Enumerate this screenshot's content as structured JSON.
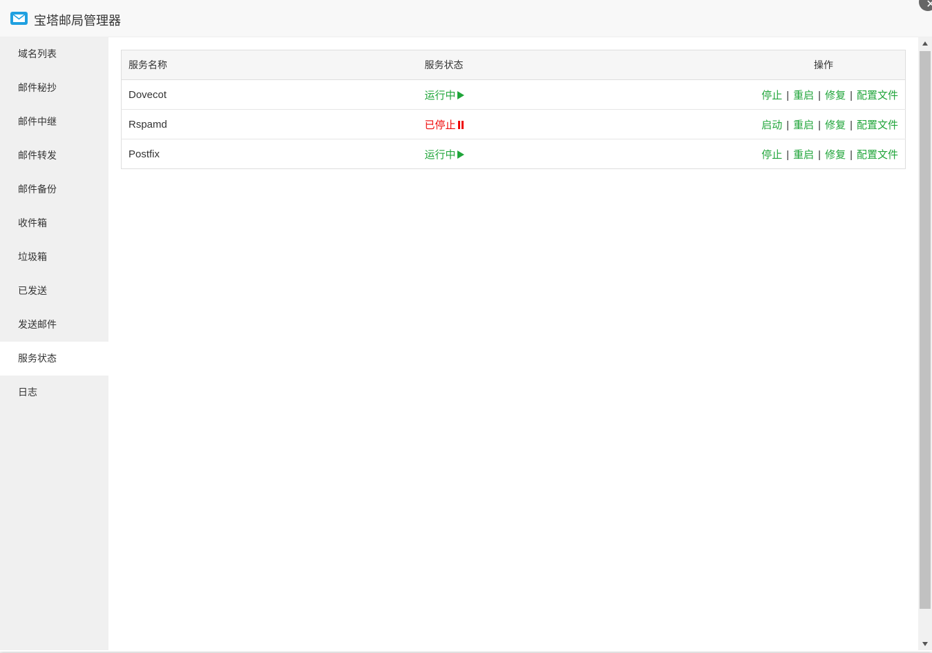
{
  "window": {
    "title": "宝塔邮局管理器",
    "icon": "mail-icon",
    "close_icon": "close-icon"
  },
  "sidebar": {
    "items": [
      {
        "label": "域名列表"
      },
      {
        "label": "邮件秘抄"
      },
      {
        "label": "邮件中继"
      },
      {
        "label": "邮件转发"
      },
      {
        "label": "邮件备份"
      },
      {
        "label": "收件箱"
      },
      {
        "label": "垃圾箱"
      },
      {
        "label": "已发送"
      },
      {
        "label": "发送邮件"
      },
      {
        "label": "服务状态",
        "active": true
      },
      {
        "label": "日志"
      }
    ]
  },
  "table": {
    "headers": {
      "name": "服务名称",
      "status": "服务状态",
      "ops": "操作"
    },
    "rows": [
      {
        "name": "Dovecot",
        "status": "运行中",
        "status_type": "running",
        "ops": {
          "toggle": "停止",
          "restart": "重启",
          "repair": "修复",
          "config": "配置文件"
        }
      },
      {
        "name": "Rspamd",
        "status": "已停止",
        "status_type": "stopped",
        "ops": {
          "toggle": "启动",
          "restart": "重启",
          "repair": "修复",
          "config": "配置文件"
        }
      },
      {
        "name": "Postfix",
        "status": "运行中",
        "status_type": "running",
        "ops": {
          "toggle": "停止",
          "restart": "重启",
          "repair": "修复",
          "config": "配置文件"
        }
      }
    ],
    "separator": "|"
  },
  "colors": {
    "running": "#20a53a",
    "stopped": "#ef0808",
    "link": "#20a53a",
    "brand": "#20a0e0"
  }
}
